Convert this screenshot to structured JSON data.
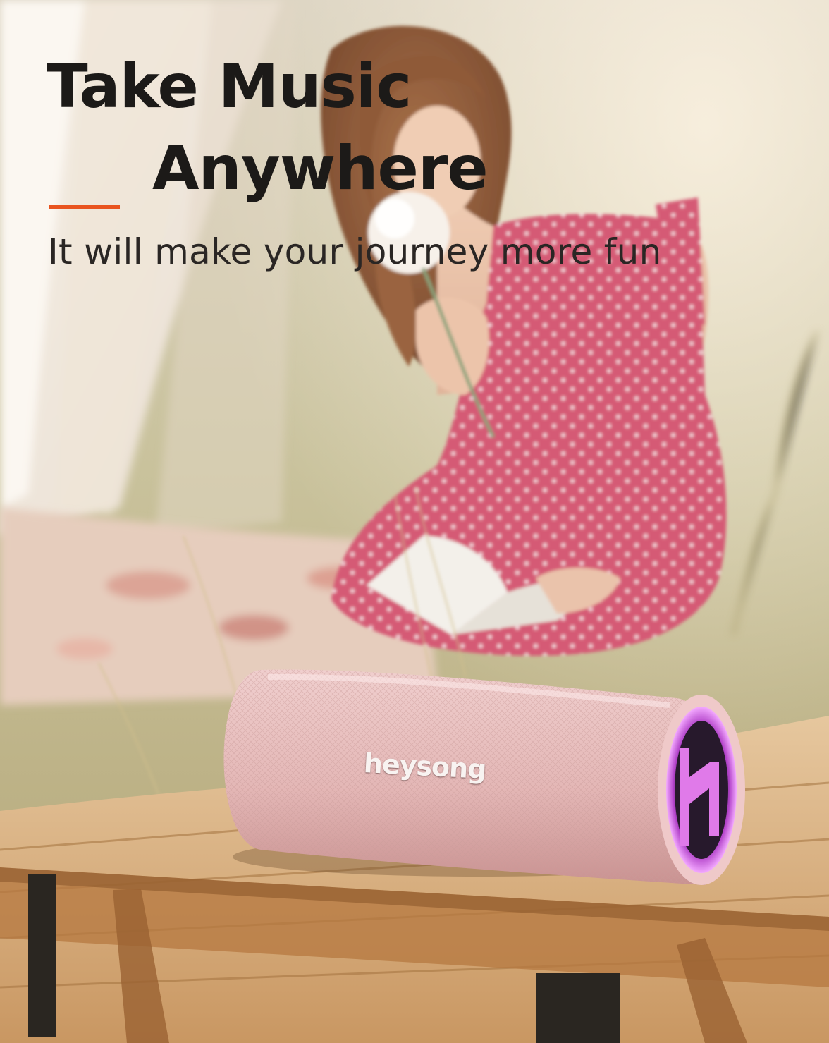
{
  "ad": {
    "headline_line1": "Take Music",
    "headline_line2": "Anywhere",
    "tagline": "It will make your journey more fun",
    "accent_color": "#e9541f",
    "product": {
      "brand_text": "heysong",
      "color": "pink",
      "light_color": "#d44ad8"
    }
  }
}
